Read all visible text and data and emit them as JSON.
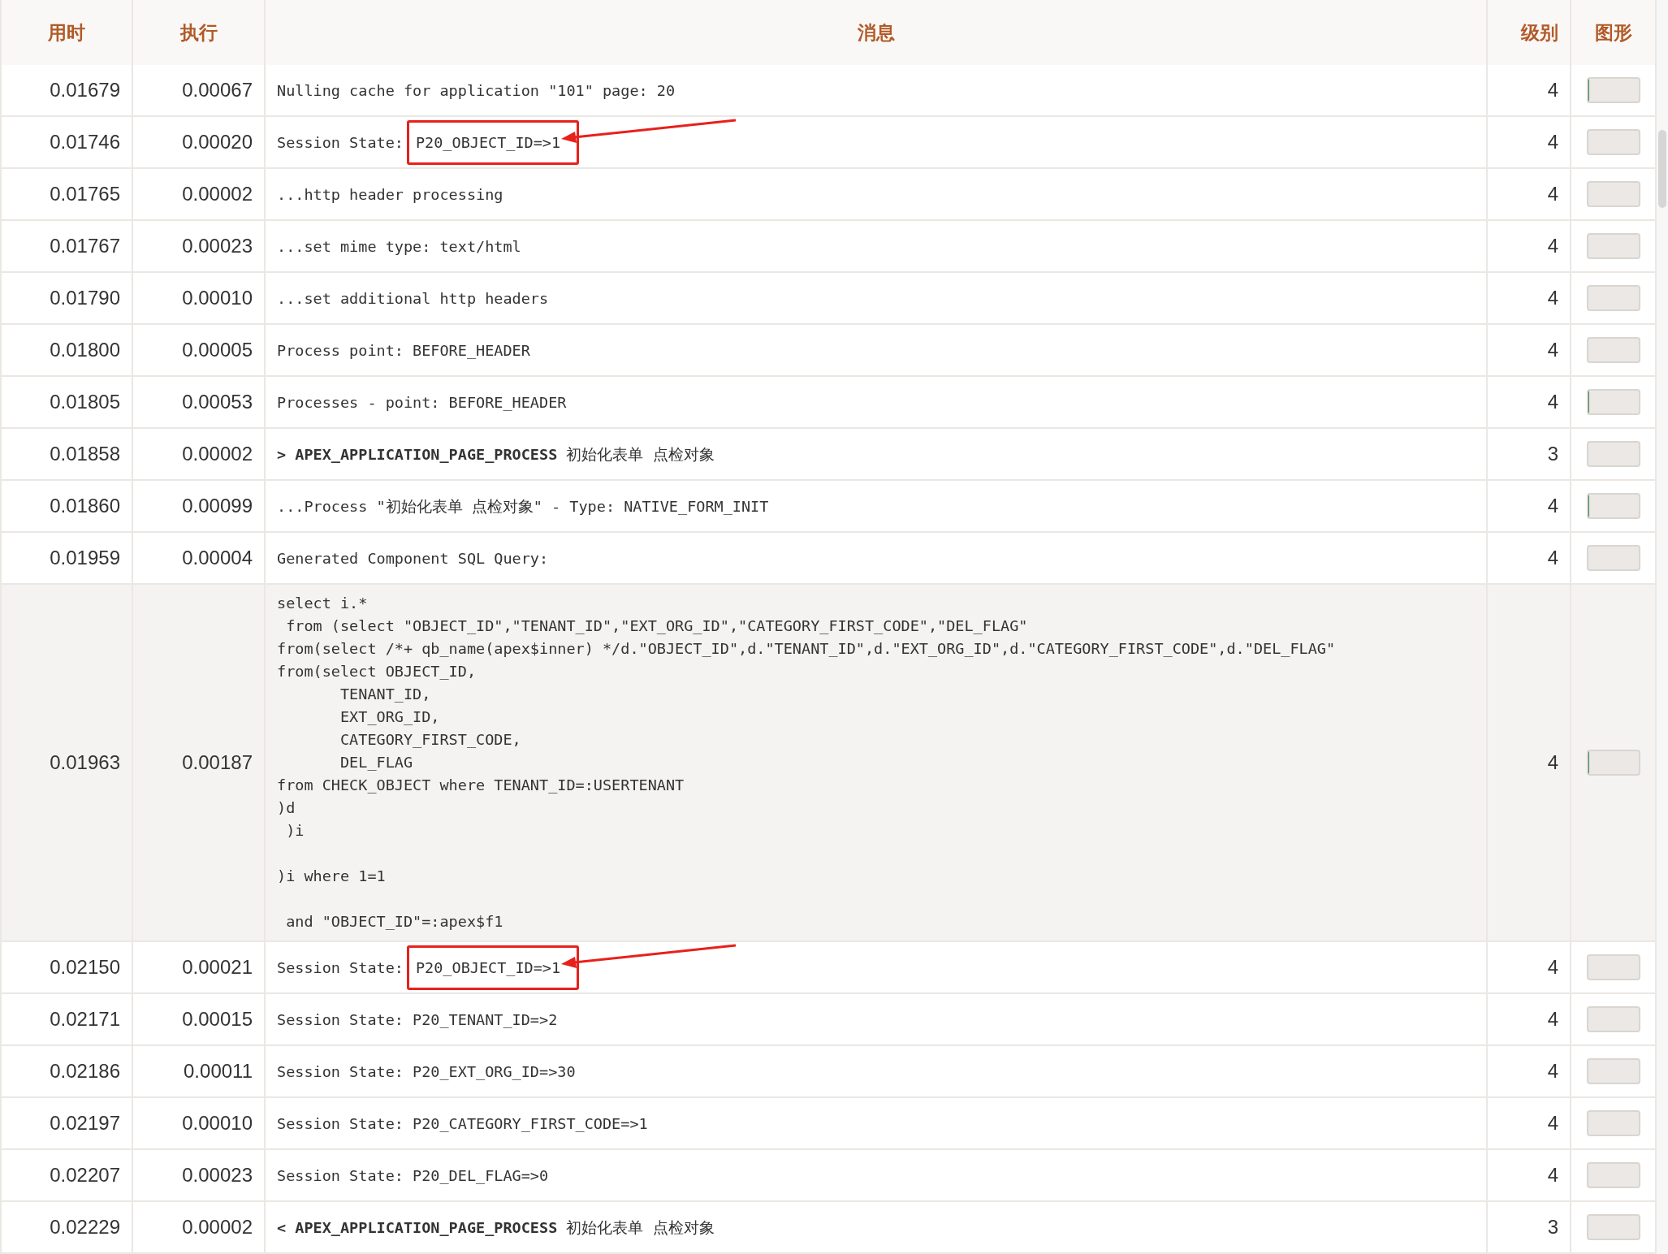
{
  "table": {
    "columns": [
      {
        "label": "用时"
      },
      {
        "label": "执行"
      },
      {
        "label": "消息"
      },
      {
        "label": "级别"
      },
      {
        "label": "图形"
      }
    ],
    "rows": [
      {
        "elapsed": "0.01679",
        "execution": "0.00067",
        "message": "Nulling cache for application \"101\" page: 20",
        "level_text": "4",
        "level": 0.02,
        "selected": false
      },
      {
        "elapsed": "0.01746",
        "execution": "0.00020",
        "message": "Session State:",
        "boxed": "P20_OBJECT_ID=>1",
        "level_text": "4",
        "level": 0,
        "selected": false
      },
      {
        "elapsed": "0.01765",
        "execution": "0.00002",
        "message": "...http header processing",
        "level_text": "4",
        "level": 0,
        "selected": false
      },
      {
        "elapsed": "0.01767",
        "execution": "0.00023",
        "message": "...set mime type: text/html",
        "level_text": "4",
        "level": 0,
        "selected": false
      },
      {
        "elapsed": "0.01790",
        "execution": "0.00010",
        "message": "...set additional http headers",
        "level_text": "4",
        "level": 0,
        "selected": false
      },
      {
        "elapsed": "0.01800",
        "execution": "0.00005",
        "message": "Process point: BEFORE_HEADER",
        "level_text": "4",
        "level": 0,
        "selected": false
      },
      {
        "elapsed": "0.01805",
        "execution": "0.00053",
        "message": "Processes - point: BEFORE_HEADER",
        "level_text": "4",
        "level": 0.02,
        "selected": false
      },
      {
        "elapsed": "0.01858",
        "execution": "0.00002",
        "message": "**> APEX_APPLICATION_PAGE_PROCESS** 初始化表单 点检对象",
        "level_text": "3",
        "level": 0,
        "selected": false
      },
      {
        "elapsed": "0.01860",
        "execution": "0.00099",
        "message": "...Process \"初始化表单 点检对象\" - Type: NATIVE_FORM_INIT",
        "level_text": "4",
        "level": 0.02,
        "selected": false
      },
      {
        "elapsed": "0.01959",
        "execution": "0.00004",
        "message": "Generated Component SQL Query:",
        "level_text": "4",
        "level": 0,
        "selected": false
      },
      {
        "elapsed": "0.01963",
        "execution": "0.00187",
        "message": "select i.*\n from (select \"OBJECT_ID\",\"TENANT_ID\",\"EXT_ORG_ID\",\"CATEGORY_FIRST_CODE\",\"DEL_FLAG\"\nfrom(select /*+ qb_name(apex$inner) */d.\"OBJECT_ID\",d.\"TENANT_ID\",d.\"EXT_ORG_ID\",d.\"CATEGORY_FIRST_CODE\",d.\"DEL_FLAG\"\nfrom(select OBJECT_ID,\n       TENANT_ID,\n       EXT_ORG_ID,\n       CATEGORY_FIRST_CODE,\n       DEL_FLAG\nfrom CHECK_OBJECT where TENANT_ID=:USERTENANT\n)d\n )i\n\n)i where 1=1\n\n and \"OBJECT_ID\"=:apex$f1",
        "level_text": "4",
        "level": 0.02,
        "selected": true
      },
      {
        "elapsed": "0.02150",
        "execution": "0.00021",
        "message": "Session State:",
        "boxed": "P20_OBJECT_ID=>1",
        "level_text": "4",
        "level": 0,
        "selected": false
      },
      {
        "elapsed": "0.02171",
        "execution": "0.00015",
        "message": "Session State: P20_TENANT_ID=>2",
        "level_text": "4",
        "level": 0,
        "selected": false
      },
      {
        "elapsed": "0.02186",
        "execution": "0.00011",
        "message": "Session State: P20_EXT_ORG_ID=>30",
        "level_text": "4",
        "level": 0,
        "selected": false
      },
      {
        "elapsed": "0.02197",
        "execution": "0.00010",
        "message": "Session State: P20_CATEGORY_FIRST_CODE=>1",
        "level_text": "4",
        "level": 0,
        "selected": false
      },
      {
        "elapsed": "0.02207",
        "execution": "0.00023",
        "message": "Session State: P20_DEL_FLAG=>0",
        "level_text": "4",
        "level": 0,
        "selected": false
      },
      {
        "elapsed": "0.02229",
        "execution": "0.00002",
        "message": "**< APEX_APPLICATION_PAGE_PROCESS** 初始化表单 点检对象",
        "level_text": "3",
        "level": 0,
        "selected": false
      }
    ]
  }
}
